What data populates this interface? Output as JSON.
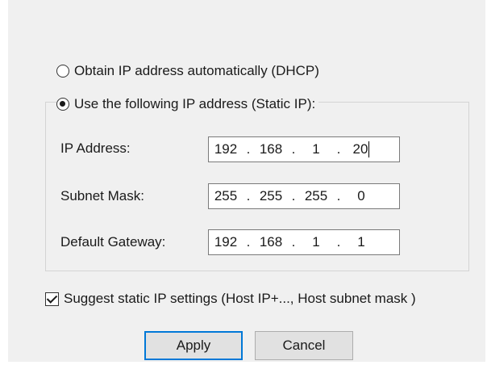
{
  "network": {
    "dhcp_label": "Obtain IP address automatically (DHCP)",
    "dhcp_selected": false,
    "static_label": "Use the following IP address (Static IP):",
    "static_selected": true
  },
  "fields": {
    "ip_address": {
      "label": "IP Address:",
      "octets": [
        "192",
        "168",
        "1",
        "20"
      ]
    },
    "subnet_mask": {
      "label": "Subnet Mask:",
      "octets": [
        "255",
        "255",
        "255",
        "0"
      ]
    },
    "default_gateway": {
      "label": "Default Gateway:",
      "octets": [
        "192",
        "168",
        "1",
        "1"
      ]
    }
  },
  "suggest": {
    "label": "Suggest static IP settings (Host IP+..., Host subnet mask )",
    "checked": true
  },
  "buttons": {
    "apply": "Apply",
    "cancel": "Cancel"
  }
}
